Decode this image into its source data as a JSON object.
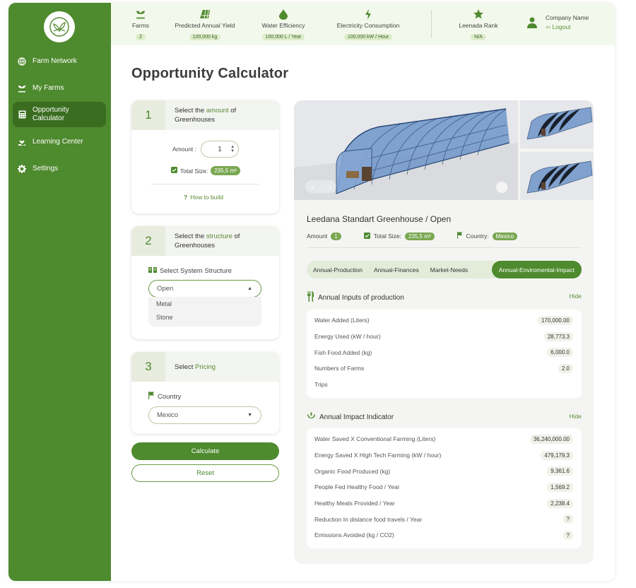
{
  "sidebar": {
    "items": [
      {
        "label": "Farm Network",
        "icon": "globe-icon"
      },
      {
        "label": "My Farms",
        "icon": "sprout-icon"
      },
      {
        "label": "Opportunity Calculator",
        "icon": "calculator-icon",
        "active": true
      },
      {
        "label": "Learning Center",
        "icon": "hand-heart-icon"
      },
      {
        "label": "Settings",
        "icon": "gear-icon"
      }
    ]
  },
  "topbar": {
    "stats": [
      {
        "label": "Farms",
        "value": "2",
        "icon": "sprout-icon"
      },
      {
        "label": "Predicted Annual Yield",
        "value": "100,000 kg",
        "icon": "field-icon"
      },
      {
        "label": "Water Efficiency",
        "value": "100,000 L / Year",
        "icon": "water-drop-icon"
      },
      {
        "label": "Electricity Consumption",
        "value": "100,000 kW / Hour",
        "icon": "lightning-icon"
      },
      {
        "label": "Leenada Rank",
        "value": "N/A",
        "icon": "star-icon"
      }
    ],
    "company_name": "Company Name",
    "logout_label": "Logout"
  },
  "page_title": "Opportunity Calculator",
  "step1": {
    "number": "1",
    "title_pre": "Select the ",
    "title_hl": "amount",
    "title_post": " of",
    "title_line2": "Greenhouses",
    "amount_label": "Amount :",
    "amount_value": "1",
    "total_size_label": "Total Size:",
    "total_size_value": "235,5 m²",
    "how_to_build": "How to build"
  },
  "step2": {
    "number": "2",
    "title_pre": "Select the ",
    "title_hl": "structure",
    "title_post": " of",
    "title_line2": "Greenhouses",
    "structure_label": "Select System Structure",
    "selected": "Open",
    "options": [
      "Metal",
      "Stone"
    ]
  },
  "step3": {
    "number": "3",
    "title_pre": "Select ",
    "title_hl": "Pricing",
    "country_label": "Country",
    "country_value": "Mexico"
  },
  "buttons": {
    "calculate": "Calculate",
    "reset": "Reset"
  },
  "product": {
    "title": "Leedana Standart Greenhouse / Open",
    "amount_label": "Amount",
    "amount_value": "1",
    "total_size_label": "Total Size:",
    "total_size_value": "235,5 m²",
    "country_label": "Country:",
    "country_value": "Mexico"
  },
  "tabs": [
    "Annual-Production",
    "Annual-Finances",
    "Market-Needs",
    "Annual-Enviromental-Impact"
  ],
  "inputs_section": {
    "title": "Annual Inputs of production",
    "hide_label": "Hide",
    "rows": [
      {
        "label": "Water Added (Liters)",
        "value": "170,000.00"
      },
      {
        "label": "Energy Used (kW / hour)",
        "value": "28,773.3"
      },
      {
        "label": "Fish Food Added (kg)",
        "value": "6,000.0"
      },
      {
        "label": "Numbers of Farms",
        "value": "2.0"
      },
      {
        "label": "Trips",
        "value": ""
      }
    ]
  },
  "impact_section": {
    "title": "Annual Impact Indicator",
    "hide_label": "Hide",
    "rows": [
      {
        "label": "Water Saved X Conventional Farming (Liters)",
        "value": "36,240,000.00"
      },
      {
        "label": "Energy Saved X High Tech Farming (kW / hour)",
        "value": "479,179.3"
      },
      {
        "label": "Organic Food Produced (kg)",
        "value": "9,361.6"
      },
      {
        "label": "People Fed Healthy Food / Year",
        "value": "1,569.2"
      },
      {
        "label": "Healthy Meals Provided / Year",
        "value": "2,238.4"
      },
      {
        "label": "Reduction In distance food travels / Year",
        "value": "?"
      },
      {
        "label": "Emissions Avoided (kg / CO2)",
        "value": "?"
      }
    ]
  },
  "colors": {
    "primary": "#4e8a2e",
    "primary_dark": "#3a6d20",
    "accent_light": "#e3ecd9"
  }
}
